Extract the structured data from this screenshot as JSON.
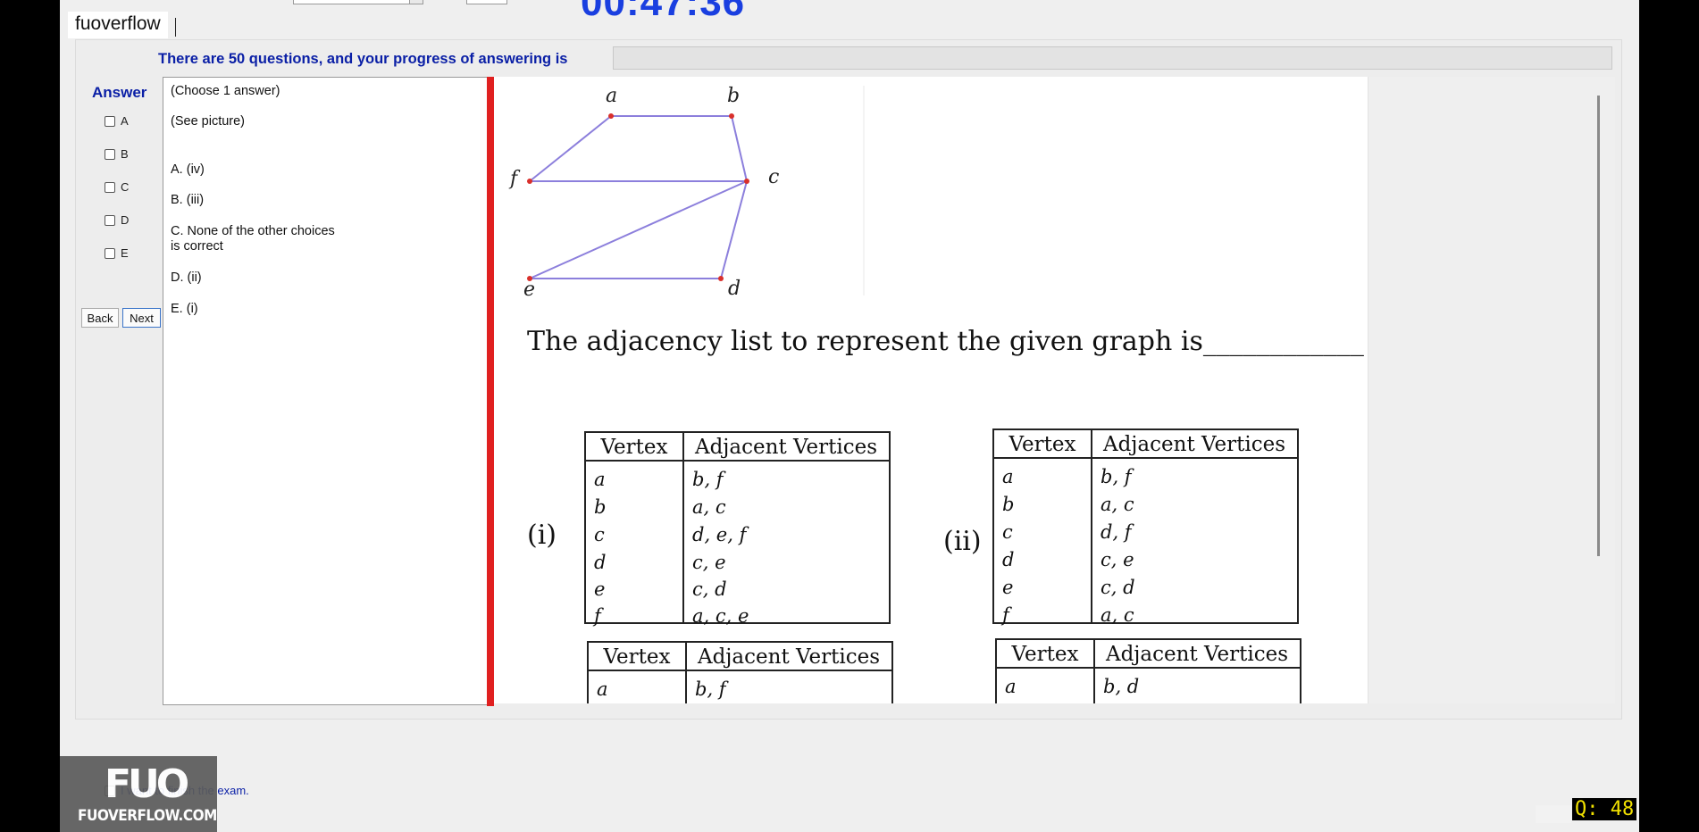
{
  "app": {
    "brand": "fuoverflow",
    "timer": "00:47:36"
  },
  "progress": {
    "text": "There are 50 questions, and your progress of answering is",
    "value": 0
  },
  "answer_panel": {
    "title": "Answer",
    "options": [
      "A",
      "B",
      "C",
      "D",
      "E"
    ],
    "back_label": "Back",
    "next_label": "Next"
  },
  "question": {
    "instruction": "(Choose 1 answer)",
    "see_picture": "(See picture)",
    "choices": [
      {
        "label": "A.",
        "text": "(iv)"
      },
      {
        "label": "B.",
        "text": "(iii)"
      },
      {
        "label": "C.",
        "text": "None of the other choices",
        "text2": "is correct"
      },
      {
        "label": "D.",
        "text": "(ii)"
      },
      {
        "label": "E.",
        "text": "(i)"
      }
    ]
  },
  "figure": {
    "vertices": [
      "a",
      "b",
      "c",
      "d",
      "e",
      "f"
    ],
    "prompt": "The adjacency list to represent the given graph is____________",
    "table_headers": [
      "Vertex",
      "Adjacent Vertices"
    ],
    "tables": [
      {
        "label": "(i)",
        "rows": [
          [
            "a",
            "b, f"
          ],
          [
            "b",
            "a, c"
          ],
          [
            "c",
            "d, e, f"
          ],
          [
            "d",
            "c, e"
          ],
          [
            "e",
            "c, d"
          ],
          [
            "f",
            "a, c, e"
          ]
        ]
      },
      {
        "label": "(ii)",
        "rows": [
          [
            "a",
            "b, f"
          ],
          [
            "b",
            "a, c"
          ],
          [
            "c",
            "d, f"
          ],
          [
            "d",
            "c, e"
          ],
          [
            "e",
            "c, d"
          ],
          [
            "f",
            "a, c"
          ]
        ]
      },
      {
        "label": "",
        "rows": [
          [
            "a",
            "b, f"
          ]
        ]
      },
      {
        "label": "",
        "rows": [
          [
            "a",
            "b, d"
          ]
        ]
      }
    ],
    "edge_color": "#8c7fdc",
    "vertex_color": "#d9302c"
  },
  "footer": {
    "finish_text": "I want to finish the exam.",
    "logo_mark": "FUO",
    "logo_text": "FUOVERFLOW.COM",
    "question_counter": "Q: 48"
  }
}
